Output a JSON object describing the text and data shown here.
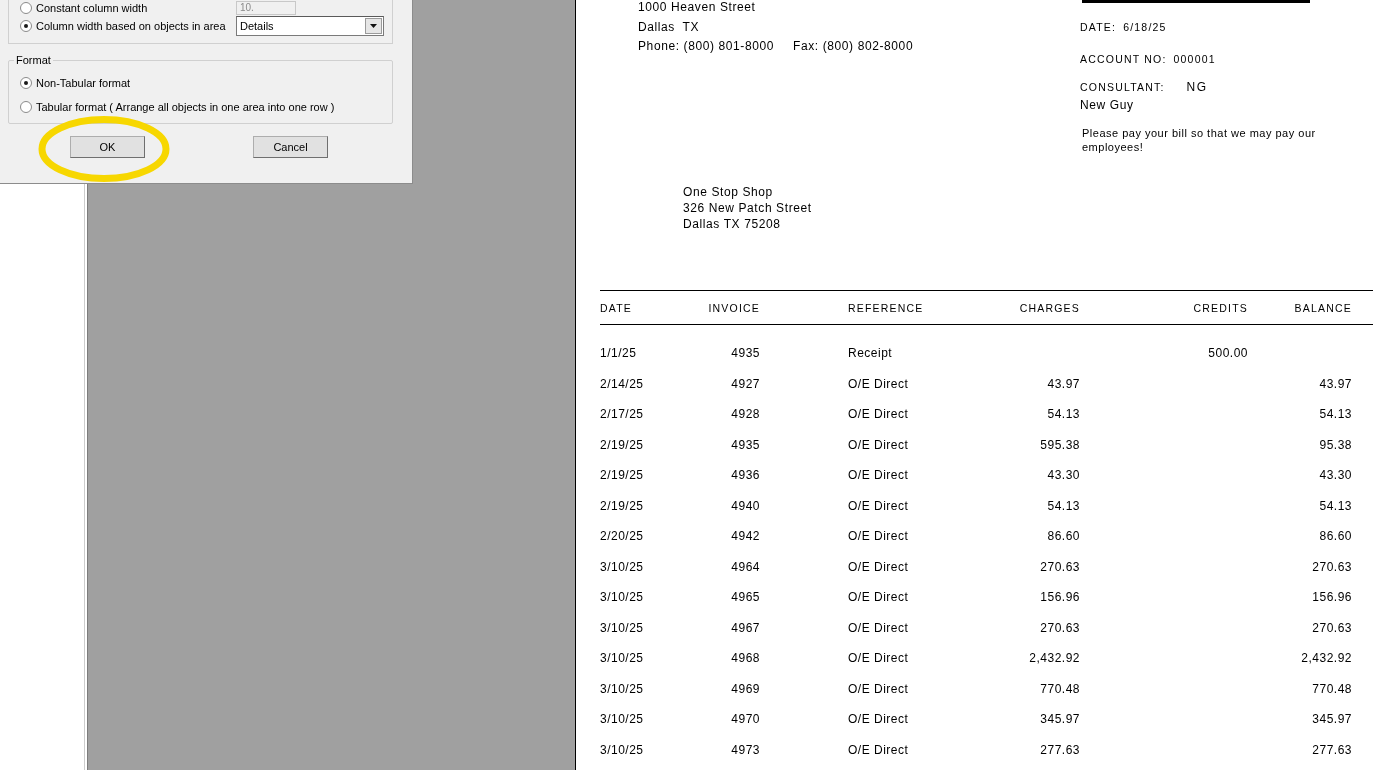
{
  "dialog": {
    "column_options": [
      {
        "label": "Constant column width",
        "selected": false,
        "kind": "field",
        "field": {
          "value": "10.",
          "disabled": true
        }
      },
      {
        "label": "Column width based on objects in area",
        "selected": true,
        "kind": "dropdown",
        "dropdown": {
          "value": "Details"
        }
      }
    ],
    "format_group": {
      "title": "Format",
      "options": [
        {
          "label": "Non-Tabular format",
          "selected": true
        },
        {
          "label": "Tabular format  ( Arrange all objects in one area into one row )",
          "selected": false
        }
      ]
    },
    "buttons": [
      {
        "label": "OK",
        "highlighted": true
      },
      {
        "label": "Cancel",
        "highlighted": false
      }
    ]
  },
  "report": {
    "company_address": [
      "1000 Heaven Street",
      "Dallas  TX"
    ],
    "phone": "Phone: (800) 801-8000",
    "fax": "Fax: (800) 802-8000",
    "date": {
      "label": "DATE:",
      "value": "6/18/25"
    },
    "account_no": {
      "label": "ACCOUNT NO:",
      "value": "000001"
    },
    "consultant": {
      "label": "CONSULTANT:",
      "code": "NG",
      "name": "New Guy"
    },
    "note": "Please pay your bill so that we may pay our employees!",
    "customer_address": [
      "One Stop Shop",
      "326 New Patch Street",
      "Dallas TX 75208"
    ],
    "table": {
      "columns": [
        "DATE",
        "INVOICE",
        "REFERENCE",
        "CHARGES",
        "CREDITS",
        "BALANCE"
      ],
      "rows": [
        {
          "date": "1/1/25",
          "invoice": "4935",
          "reference": "Receipt",
          "credits": "500.00"
        },
        {
          "date": "2/14/25",
          "invoice": "4927",
          "reference": "O/E Direct",
          "charges": "43.97",
          "balance": "43.97"
        },
        {
          "date": "2/17/25",
          "invoice": "4928",
          "reference": "O/E Direct",
          "charges": "54.13",
          "balance": "54.13"
        },
        {
          "date": "2/19/25",
          "invoice": "4935",
          "reference": "O/E Direct",
          "charges": "595.38",
          "balance": "95.38"
        },
        {
          "date": "2/19/25",
          "invoice": "4936",
          "reference": "O/E Direct",
          "charges": "43.30",
          "balance": "43.30"
        },
        {
          "date": "2/19/25",
          "invoice": "4940",
          "reference": "O/E Direct",
          "charges": "54.13",
          "balance": "54.13"
        },
        {
          "date": "2/20/25",
          "invoice": "4942",
          "reference": "O/E Direct",
          "charges": "86.60",
          "balance": "86.60"
        },
        {
          "date": "3/10/25",
          "invoice": "4964",
          "reference": "O/E Direct",
          "charges": "270.63",
          "balance": "270.63"
        },
        {
          "date": "3/10/25",
          "invoice": "4965",
          "reference": "O/E Direct",
          "charges": "156.96",
          "balance": "156.96"
        },
        {
          "date": "3/10/25",
          "invoice": "4967",
          "reference": "O/E Direct",
          "charges": "270.63",
          "balance": "270.63"
        },
        {
          "date": "3/10/25",
          "invoice": "4968",
          "reference": "O/E Direct",
          "charges": "2,432.92",
          "balance": "2,432.92"
        },
        {
          "date": "3/10/25",
          "invoice": "4969",
          "reference": "O/E Direct",
          "charges": "770.48",
          "balance": "770.48"
        },
        {
          "date": "3/10/25",
          "invoice": "4970",
          "reference": "O/E Direct",
          "charges": "345.97",
          "balance": "345.97"
        },
        {
          "date": "3/10/25",
          "invoice": "4973",
          "reference": "O/E Direct",
          "charges": "277.63",
          "balance": "277.63"
        }
      ]
    }
  }
}
